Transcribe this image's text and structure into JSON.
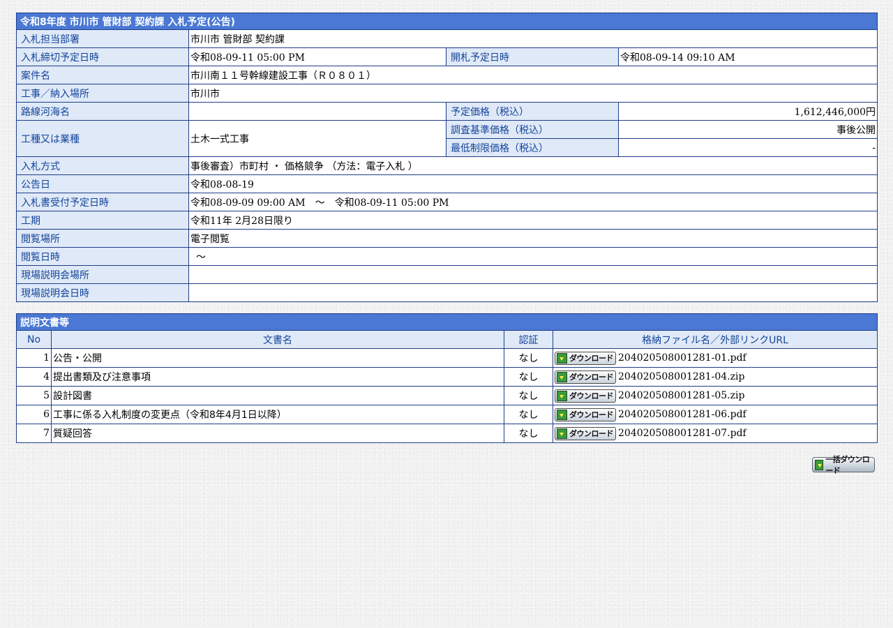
{
  "notice": {
    "title": "令和8年度 市川市 管財部 契約課 入札予定(公告)",
    "rows": {
      "dept": {
        "label": "入札担当部署",
        "value": "市川市 管財部 契約課"
      },
      "deadline": {
        "label": "入札締切予定日時",
        "value": "令和08-09-11 05:00 PM"
      },
      "opening": {
        "label": "開札予定日時",
        "value": "令和08-09-14 09:10 AM"
      },
      "project": {
        "label": "案件名",
        "value": "市川南１１号幹線建設工事（Ｒ０８０１）"
      },
      "location": {
        "label": "工事／納入場所",
        "value": "市川市"
      },
      "route": {
        "label": "路線河海名",
        "value": ""
      },
      "planned_price": {
        "label": "予定価格（税込）",
        "value": "1,612,446,000円"
      },
      "category": {
        "label": "工種又は業種",
        "value": "土木一式工事"
      },
      "survey_price": {
        "label": "調査基準価格（税込）",
        "value": "事後公開"
      },
      "min_price": {
        "label": "最低制限価格（税込）",
        "value": "-"
      },
      "method": {
        "label": "入札方式",
        "value": "事後審査）市町村 ・ 価格競争 （方法：電子入札 ）"
      },
      "announce_date": {
        "label": "公告日",
        "value": "令和08-08-19"
      },
      "acceptance": {
        "label": "入札書受付予定日時",
        "value": "令和08-09-09 09:00 AM　～　令和08-09-11 05:00 PM"
      },
      "period": {
        "label": "工期",
        "value": "令和11年 2月28日限り"
      },
      "view_place": {
        "label": "閲覧場所",
        "value": "電子閲覧"
      },
      "view_date": {
        "label": "閲覧日時",
        "value": "～"
      },
      "briefing_place": {
        "label": "現場説明会場所",
        "value": ""
      },
      "briefing_date": {
        "label": "現場説明会日時",
        "value": ""
      }
    }
  },
  "documents": {
    "title": "説明文書等",
    "headers": {
      "no": "No",
      "name": "文書名",
      "auth": "認証",
      "file": "格納ファイル名／外部リンクURL"
    },
    "download_label": "ダウンロード",
    "rows": [
      {
        "no": "1",
        "name": "公告・公開",
        "auth": "なし",
        "file": "204020508001281-01.pdf"
      },
      {
        "no": "4",
        "name": "提出書類及び注意事項",
        "auth": "なし",
        "file": "204020508001281-04.zip"
      },
      {
        "no": "5",
        "name": "設計図書",
        "auth": "なし",
        "file": "204020508001281-05.zip"
      },
      {
        "no": "6",
        "name": "工事に係る入札制度の変更点（令和8年4月1日以降）",
        "auth": "なし",
        "file": "204020508001281-06.pdf"
      },
      {
        "no": "7",
        "name": "質疑回答",
        "auth": "なし",
        "file": "204020508001281-07.pdf"
      }
    ]
  },
  "bulk_download_label": "一括ダウンロード",
  "colors": {
    "header_bg": "#4a78d4",
    "label_bg": "#dfe9f7",
    "label_text": "#14449a",
    "border": "#1f3d8a"
  },
  "icons": {
    "download": "download-arrow-icon"
  }
}
